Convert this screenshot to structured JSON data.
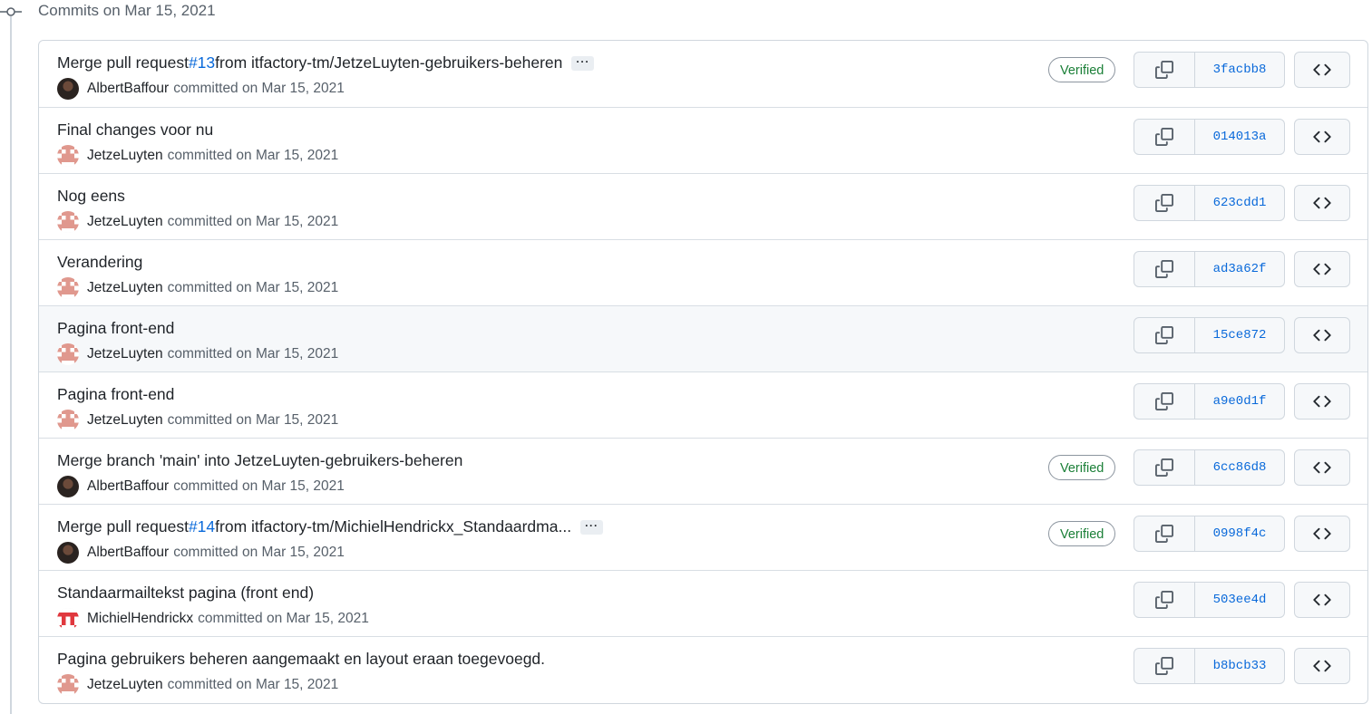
{
  "group": {
    "title": "Commits on Mar 15, 2021"
  },
  "commits": [
    {
      "message_pre": "Merge pull request ",
      "pr": "#13",
      "message_post": " from itfactory-tm/JetzeLuyten-gebruikers-beheren",
      "has_more": true,
      "author": "AlbertBaffour",
      "avatar": "dark",
      "date_text": "committed on Mar 15, 2021",
      "verified": "Verified",
      "sha": "3facbb8"
    },
    {
      "message_pre": "Final changes voor nu",
      "pr": "",
      "message_post": "",
      "has_more": false,
      "author": "JetzeLuyten",
      "avatar": "jetze",
      "date_text": "committed on Mar 15, 2021",
      "verified": "",
      "sha": "014013a"
    },
    {
      "message_pre": "Nog eens",
      "pr": "",
      "message_post": "",
      "has_more": false,
      "author": "JetzeLuyten",
      "avatar": "jetze",
      "date_text": "committed on Mar 15, 2021",
      "verified": "",
      "sha": "623cdd1"
    },
    {
      "message_pre": "Verandering",
      "pr": "",
      "message_post": "",
      "has_more": false,
      "author": "JetzeLuyten",
      "avatar": "jetze",
      "date_text": "committed on Mar 15, 2021",
      "verified": "",
      "sha": "ad3a62f"
    },
    {
      "message_pre": "Pagina front-end",
      "pr": "",
      "message_post": "",
      "has_more": false,
      "author": "JetzeLuyten",
      "avatar": "jetze",
      "date_text": "committed on Mar 15, 2021",
      "verified": "",
      "sha": "15ce872",
      "hover": true
    },
    {
      "message_pre": "Pagina front-end",
      "pr": "",
      "message_post": "",
      "has_more": false,
      "author": "JetzeLuyten",
      "avatar": "jetze",
      "date_text": "committed on Mar 15, 2021",
      "verified": "",
      "sha": "a9e0d1f"
    },
    {
      "message_pre": "Merge branch 'main' into JetzeLuyten-gebruikers-beheren",
      "pr": "",
      "message_post": "",
      "has_more": false,
      "author": "AlbertBaffour",
      "avatar": "dark",
      "date_text": "committed on Mar 15, 2021",
      "verified": "Verified",
      "sha": "6cc86d8"
    },
    {
      "message_pre": "Merge pull request ",
      "pr": "#14",
      "message_post": " from itfactory-tm/MichielHendrickx_Standaardma...",
      "has_more": true,
      "author": "AlbertBaffour",
      "avatar": "dark",
      "date_text": "committed on Mar 15, 2021",
      "verified": "Verified",
      "sha": "0998f4c"
    },
    {
      "message_pre": "Standaarmailtekst pagina (front end)",
      "pr": "",
      "message_post": "",
      "has_more": false,
      "author": "MichielHendrickx",
      "avatar": "michiel",
      "date_text": "committed on Mar 15, 2021",
      "verified": "",
      "sha": "503ee4d"
    },
    {
      "message_pre": "Pagina gebruikers beheren aangemaakt en layout eraan toegevoegd.",
      "pr": "",
      "message_post": "",
      "has_more": false,
      "author": "JetzeLuyten",
      "avatar": "jetze",
      "date_text": "committed on Mar 15, 2021",
      "verified": "",
      "sha": "b8bcb33"
    }
  ],
  "icons": {
    "timeline": "git-commit-icon",
    "copy": "copy-icon",
    "browse": "code-icon",
    "more": "ellipsis-icon"
  },
  "colors": {
    "link": "#0969da",
    "verified": "#1a7f37",
    "border": "#d0d7de",
    "hover_bg": "#f6f8fa"
  }
}
